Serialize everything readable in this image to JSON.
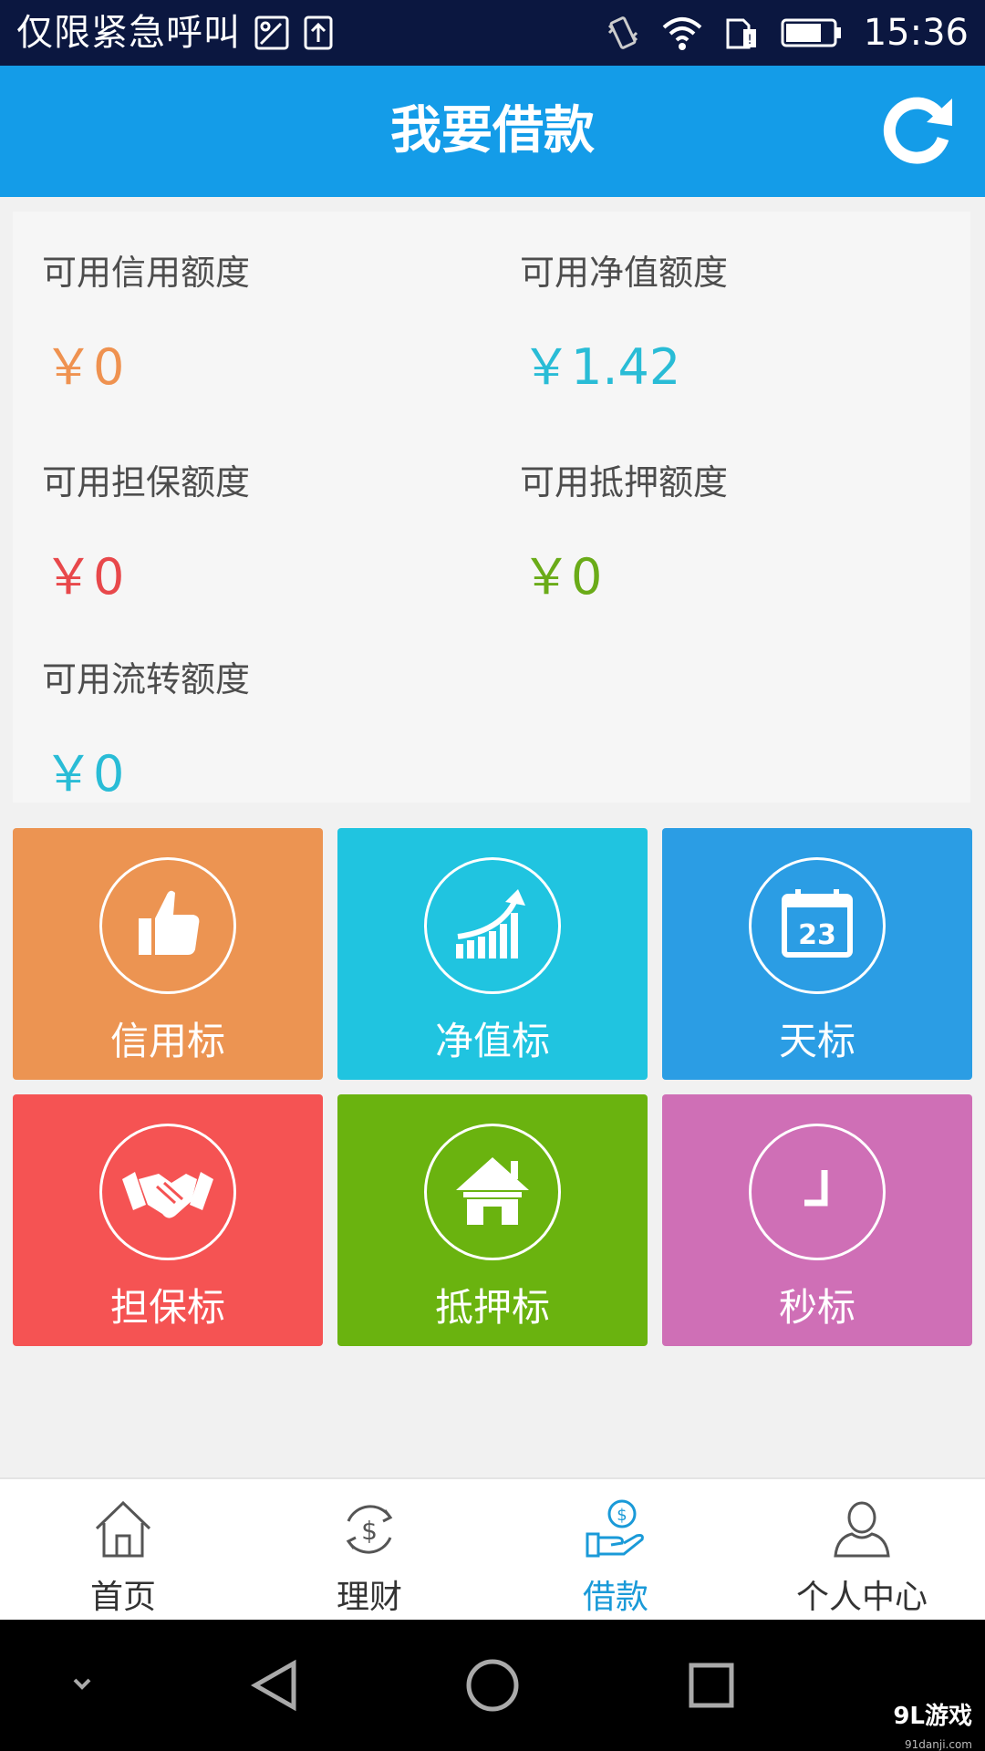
{
  "status_bar": {
    "carrier_text": "仅限紧急呼叫",
    "time": "15:36"
  },
  "header": {
    "title": "我要借款"
  },
  "quotas": [
    {
      "label": "可用信用额度",
      "value": "￥0",
      "color": "#ef9250"
    },
    {
      "label": "可用净值额度",
      "value": "￥1.42",
      "color": "#29bcd6"
    },
    {
      "label": "可用担保额度",
      "value": "￥0",
      "color": "#e8484b"
    },
    {
      "label": "可用抵押额度",
      "value": "￥0",
      "color": "#6aab18"
    },
    {
      "label": "可用流转额度",
      "value": "￥0",
      "color": "#29bcd6"
    }
  ],
  "tiles": [
    {
      "label": "信用标",
      "color": "#ec9452",
      "icon": "thumbs-up-icon"
    },
    {
      "label": "净值标",
      "color": "#20c4e0",
      "icon": "growth-chart-icon"
    },
    {
      "label": "天标",
      "color": "#2b9de4",
      "icon": "calendar-icon",
      "icon_text": "23"
    },
    {
      "label": "担保标",
      "color": "#f55353",
      "icon": "handshake-icon"
    },
    {
      "label": "抵押标",
      "color": "#6ab30f",
      "icon": "house-icon"
    },
    {
      "label": "秒标",
      "color": "#cf6fb6",
      "icon": "clock-icon"
    }
  ],
  "bottom_nav": {
    "items": [
      {
        "label": "首页",
        "icon": "home-icon",
        "active": false
      },
      {
        "label": "理财",
        "icon": "finance-icon",
        "active": false
      },
      {
        "label": "借款",
        "icon": "loan-icon",
        "active": true
      },
      {
        "label": "个人中心",
        "icon": "user-icon",
        "active": false
      }
    ],
    "active_color": "#1a9ad8",
    "inactive_color": "#333333"
  },
  "watermark": {
    "text": "9L游戏",
    "sub": "91danji.com"
  }
}
